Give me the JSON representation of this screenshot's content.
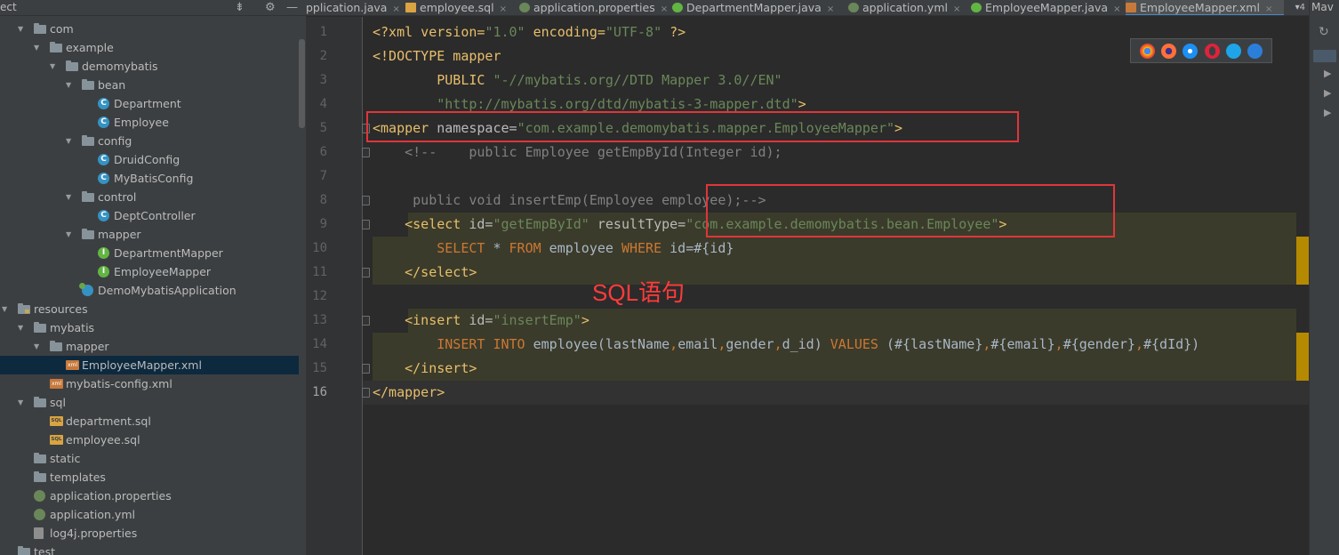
{
  "sidebar": {
    "title": "ect",
    "tree": [
      {
        "label": "com",
        "depth": 0,
        "icon": "folder-icon",
        "expanded": true
      },
      {
        "label": "example",
        "depth": 1,
        "icon": "folder-icon",
        "expanded": true
      },
      {
        "label": "demomybatis",
        "depth": 2,
        "icon": "folder-icon",
        "expanded": true
      },
      {
        "label": "bean",
        "depth": 3,
        "icon": "folder-icon",
        "expanded": true
      },
      {
        "label": "Department",
        "depth": 4,
        "icon": "class-icon"
      },
      {
        "label": "Employee",
        "depth": 4,
        "icon": "class-icon"
      },
      {
        "label": "config",
        "depth": 3,
        "icon": "folder-icon",
        "expanded": true
      },
      {
        "label": "DruidConfig",
        "depth": 4,
        "icon": "class-icon"
      },
      {
        "label": "MyBatisConfig",
        "depth": 4,
        "icon": "class-icon"
      },
      {
        "label": "control",
        "depth": 3,
        "icon": "folder-icon",
        "expanded": true
      },
      {
        "label": "DeptController",
        "depth": 4,
        "icon": "class-icon"
      },
      {
        "label": "mapper",
        "depth": 3,
        "icon": "folder-icon",
        "expanded": true
      },
      {
        "label": "DepartmentMapper",
        "depth": 4,
        "icon": "interface-icon"
      },
      {
        "label": "EmployeeMapper",
        "depth": 4,
        "icon": "interface-icon"
      },
      {
        "label": "DemoMybatisApplication",
        "depth": 3,
        "icon": "spring-app-icon"
      },
      {
        "label": "resources",
        "depth": -1,
        "icon": "resources-folder-icon",
        "expanded": true
      },
      {
        "label": "mybatis",
        "depth": 0,
        "icon": "folder-icon",
        "expanded": true
      },
      {
        "label": "mapper",
        "depth": 1,
        "icon": "folder-icon",
        "expanded": true
      },
      {
        "label": "EmployeeMapper.xml",
        "depth": 2,
        "icon": "xml-file-icon",
        "selected": true
      },
      {
        "label": "mybatis-config.xml",
        "depth": 1,
        "icon": "xml-file-icon"
      },
      {
        "label": "sql",
        "depth": 0,
        "icon": "folder-icon",
        "expanded": true
      },
      {
        "label": "department.sql",
        "depth": 1,
        "icon": "sql-file-icon"
      },
      {
        "label": "employee.sql",
        "depth": 1,
        "icon": "sql-file-icon"
      },
      {
        "label": "static",
        "depth": 0,
        "icon": "folder-icon"
      },
      {
        "label": "templates",
        "depth": 0,
        "icon": "folder-icon"
      },
      {
        "label": "application.properties",
        "depth": 0,
        "icon": "spring-leaf-icon"
      },
      {
        "label": "application.yml",
        "depth": 0,
        "icon": "spring-leaf-icon"
      },
      {
        "label": "log4j.properties",
        "depth": 0,
        "icon": "properties-file-icon"
      },
      {
        "label": "test",
        "depth": -1,
        "icon": "folder-icon"
      }
    ]
  },
  "tabs": [
    {
      "label": "pplication.java",
      "icon": "none"
    },
    {
      "label": "employee.sql",
      "icon": "sql"
    },
    {
      "label": "application.properties",
      "icon": "leaf"
    },
    {
      "label": "DepartmentMapper.java",
      "icon": "iface"
    },
    {
      "label": "application.yml",
      "icon": "leaf"
    },
    {
      "label": "EmployeeMapper.java",
      "icon": "iface"
    },
    {
      "label": "EmployeeMapper.xml",
      "icon": "xml",
      "active": true
    }
  ],
  "tab_overflow": "▾4",
  "editor": {
    "line_numbers": [
      "1",
      "2",
      "3",
      "4",
      "5",
      "6",
      "7",
      "8",
      "9",
      "10",
      "11",
      "12",
      "13",
      "14",
      "15",
      "16"
    ],
    "current_line": "16",
    "lines": [
      [
        {
          "t": "<?xml version=",
          "c": "tag"
        },
        {
          "t": "\"1.0\"",
          "c": "str"
        },
        {
          "t": " encoding=",
          "c": "tag"
        },
        {
          "t": "\"UTF-8\"",
          "c": "str"
        },
        {
          "t": " ?>",
          "c": "tag"
        }
      ],
      [
        {
          "t": "<!DOCTYPE mapper",
          "c": "tag"
        }
      ],
      [
        {
          "t": "        PUBLIC ",
          "c": "tag"
        },
        {
          "t": "\"-//mybatis.org//DTD Mapper 3.0//EN\"",
          "c": "str"
        }
      ],
      [
        {
          "t": "        ",
          "c": "plain"
        },
        {
          "t": "\"http://mybatis.org/dtd/mybatis-3-mapper.dtd\"",
          "c": "str"
        },
        {
          "t": ">",
          "c": "tag"
        }
      ],
      [
        {
          "t": "<mapper",
          "c": "tag"
        },
        {
          "t": " namespace=",
          "c": "attr"
        },
        {
          "t": "\"com.example.demomybatis.mapper.EmployeeMapper\"",
          "c": "str"
        },
        {
          "t": ">",
          "c": "tag"
        }
      ],
      [
        {
          "t": "    <!--    public Employee getEmpById(Integer id);",
          "c": "com"
        }
      ],
      [
        {
          "t": "",
          "c": "com"
        }
      ],
      [
        {
          "t": "     public void insertEmp(Employee employee);-->",
          "c": "com"
        }
      ],
      [
        {
          "t": "    <select",
          "c": "tag"
        },
        {
          "t": " id=",
          "c": "attr"
        },
        {
          "t": "\"getEmpById\"",
          "c": "str"
        },
        {
          "t": " resultType=",
          "c": "attr"
        },
        {
          "t": "\"com.example.demomybatis.bean.Employee\"",
          "c": "str"
        },
        {
          "t": ">",
          "c": "tag"
        }
      ],
      [
        {
          "t": "        ",
          "c": "plain"
        },
        {
          "t": "SELECT",
          "c": "kw"
        },
        {
          "t": " * ",
          "c": "plain"
        },
        {
          "t": "FROM",
          "c": "kw"
        },
        {
          "t": " employee ",
          "c": "plain"
        },
        {
          "t": "WHERE",
          "c": "kw"
        },
        {
          "t": " id=#{id}",
          "c": "plain"
        }
      ],
      [
        {
          "t": "    </select>",
          "c": "tag"
        }
      ],
      [
        {
          "t": "",
          "c": "plain"
        }
      ],
      [
        {
          "t": "    <insert",
          "c": "tag"
        },
        {
          "t": " id=",
          "c": "attr"
        },
        {
          "t": "\"insertEmp\"",
          "c": "str"
        },
        {
          "t": ">",
          "c": "tag"
        }
      ],
      [
        {
          "t": "        ",
          "c": "plain"
        },
        {
          "t": "INSERT INTO",
          "c": "kw"
        },
        {
          "t": " employee(lastName",
          "c": "plain"
        },
        {
          "t": ",",
          "c": "kw"
        },
        {
          "t": "email",
          "c": "plain"
        },
        {
          "t": ",",
          "c": "kw"
        },
        {
          "t": "gender",
          "c": "plain"
        },
        {
          "t": ",",
          "c": "kw"
        },
        {
          "t": "d_id) ",
          "c": "plain"
        },
        {
          "t": "VALUES",
          "c": "kw"
        },
        {
          "t": " (#{lastName}",
          "c": "plain"
        },
        {
          "t": ",",
          "c": "kw"
        },
        {
          "t": "#{email}",
          "c": "plain"
        },
        {
          "t": ",",
          "c": "kw"
        },
        {
          "t": "#{gender}",
          "c": "plain"
        },
        {
          "t": ",",
          "c": "kw"
        },
        {
          "t": "#{dId})",
          "c": "plain"
        }
      ],
      [
        {
          "t": "    </insert>",
          "c": "tag"
        }
      ],
      [
        {
          "t": "</mapper>",
          "c": "tag"
        }
      ]
    ],
    "annotation": "SQL语句"
  },
  "browser_icons": [
    "chrome-icon",
    "firefox-icon",
    "safari-icon",
    "opera-icon",
    "ie-icon",
    "edge-icon"
  ],
  "right_strip": {
    "label": "Mav"
  },
  "colors": {
    "tag": "#e8bf6a",
    "string": "#6a8759",
    "keyword": "#cc7832",
    "comment": "#808080",
    "annotation_red": "#e0353a"
  }
}
